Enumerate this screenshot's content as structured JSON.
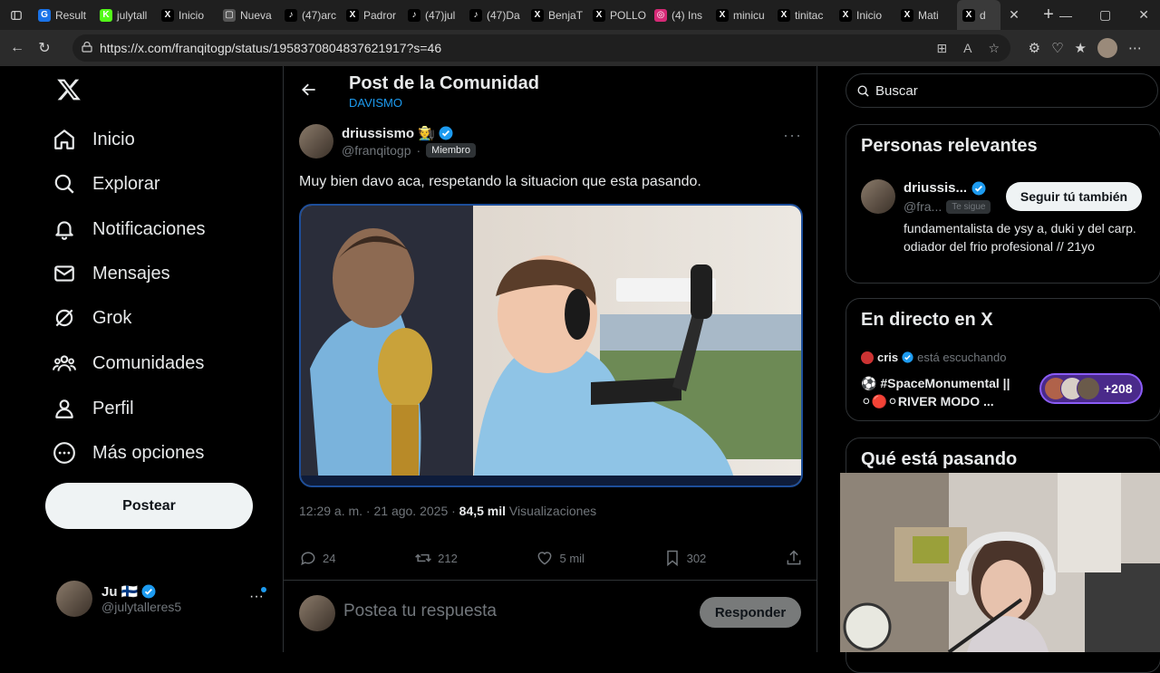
{
  "browser": {
    "tabs": [
      {
        "label": "Result",
        "fav": "G",
        "color": "#1a73e8"
      },
      {
        "label": "julytall",
        "fav": "K",
        "color": "#53fc18"
      },
      {
        "label": "Inicio",
        "fav": "X",
        "color": "#000000"
      },
      {
        "label": "Nueva",
        "fav": "▢",
        "color": "#555555"
      },
      {
        "label": "(47)arc",
        "fav": "♪",
        "color": "#000000"
      },
      {
        "label": "Padror",
        "fav": "X",
        "color": "#000000"
      },
      {
        "label": "(47)jul",
        "fav": "♪",
        "color": "#000000"
      },
      {
        "label": "(47)Da",
        "fav": "♪",
        "color": "#000000"
      },
      {
        "label": "BenjaT",
        "fav": "X",
        "color": "#000000"
      },
      {
        "label": "POLLO",
        "fav": "X",
        "color": "#000000"
      },
      {
        "label": "(4) Ins",
        "fav": "◎",
        "color": "#d62976"
      },
      {
        "label": "minicu",
        "fav": "X",
        "color": "#000000"
      },
      {
        "label": "tinitac",
        "fav": "X",
        "color": "#000000"
      },
      {
        "label": "Inicio",
        "fav": "X",
        "color": "#000000"
      },
      {
        "label": "Mati",
        "fav": "X",
        "color": "#000000"
      },
      {
        "label": "d",
        "fav": "X",
        "color": "#000000"
      }
    ],
    "url": "https://x.com/franqitogp/status/1958370804837621917?s=46"
  },
  "sidebar": {
    "items": [
      {
        "label": "Inicio",
        "icon": "home-icon"
      },
      {
        "label": "Explorar",
        "icon": "search-icon"
      },
      {
        "label": "Notificaciones",
        "icon": "bell-icon"
      },
      {
        "label": "Mensajes",
        "icon": "mail-icon"
      },
      {
        "label": "Grok",
        "icon": "grok-icon"
      },
      {
        "label": "Comunidades",
        "icon": "people-icon"
      },
      {
        "label": "Perfil",
        "icon": "person-icon"
      },
      {
        "label": "Más opciones",
        "icon": "more-circle-icon"
      }
    ],
    "post_label": "Postear",
    "account": {
      "name": "Ju 🇫🇮",
      "handle": "@julytalleres5"
    }
  },
  "main": {
    "title": "Post de la Comunidad",
    "subtitle": "DAVISMO",
    "author": {
      "name": "driussismo 🧑‍🌾",
      "handle": "@franqitogp",
      "badge": "Miembro"
    },
    "text": "Muy bien davo aca, respetando la situacion que esta pasando.",
    "meta": {
      "time": "12:29 a. m. · 21 ago. 2025 · ",
      "views": "84,5 mil",
      "views_label": " Visualizaciones"
    },
    "actions": {
      "replies": "24",
      "reposts": "212",
      "likes": "5 mil",
      "bookmarks": "302"
    },
    "reply_placeholder": "Postea tu respuesta",
    "reply_button": "Responder"
  },
  "right": {
    "search_placeholder": "Buscar",
    "relevant": {
      "title": "Personas relevantes",
      "name": "driussis...",
      "handle": "@fra...",
      "follows_you": "Te sigue",
      "button": "Seguir tú también",
      "bio": "fundamentalista de ysy a, duki y del carp. odiador del frio profesional // 21yo"
    },
    "live": {
      "title": "En directo en X",
      "host": "cris",
      "status": "está escuchando",
      "space_title": "⚽ #SpaceMonumental || ⚪🔴⚪RIVER MODO ...",
      "count": "+208"
    },
    "trending_title": "Qué está pasando"
  },
  "colors": {
    "accent": "#1d9bf0",
    "border": "#2f3336",
    "muted": "#71767b"
  }
}
